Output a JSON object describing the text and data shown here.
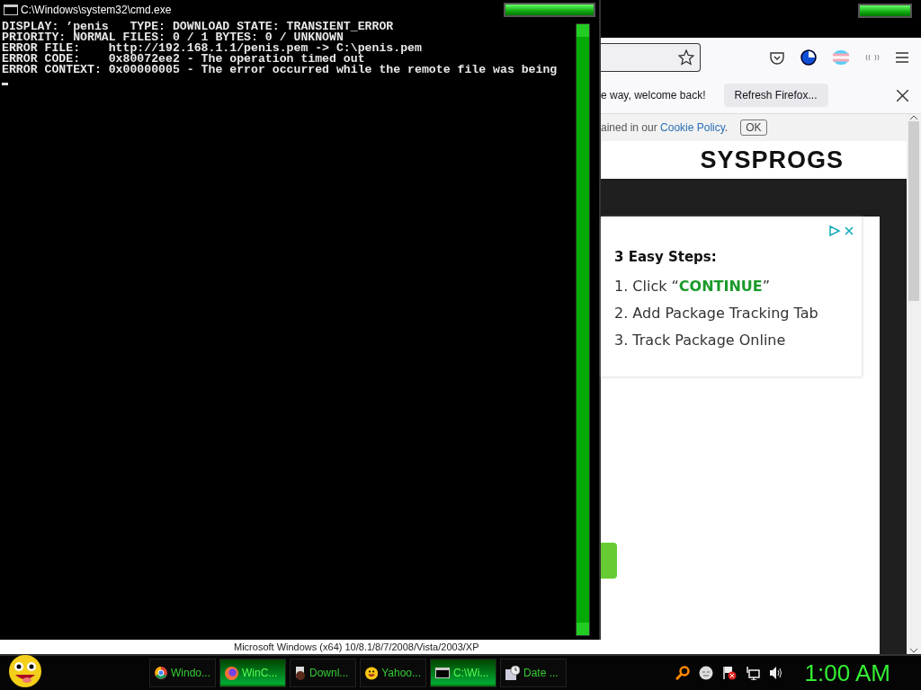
{
  "console_window": {
    "title": "C:\\Windows\\system32\\cmd.exe",
    "lines": [
      "DISPLAY: ’penis   TYPE: DOWNLOAD STATE: TRANSIENT_ERROR",
      "PRIORITY: NORMAL FILES: 0 / 1 BYTES: 0 / UNKNOWN",
      "ERROR FILE:    http://192.168.1.1/penis.pem -> C:\\penis.pem",
      "ERROR CODE:    0x80072ee2 - The operation timed out",
      "ERROR CONTEXT: 0x00000005 - The error occurred while the remote file was being"
    ]
  },
  "background_strip": {
    "text": "Microsoft Windows (x64) 10/8.1/8/7/2008/Vista/2003/XP"
  },
  "browser": {
    "notification": {
      "message": "e way, welcome back!",
      "button": "Refresh Firefox..."
    },
    "cookie_bar": {
      "text": "ained in our ",
      "link": "Cookie Policy",
      "suffix": ".",
      "button": "OK"
    },
    "logo": "SYSPROGS",
    "ad": {
      "heading": "3 Easy Steps:",
      "steps": [
        "1. Click “**CONTINUE**”",
        "2. Add Package Tracking Tab",
        "3. Track Package Online"
      ]
    }
  },
  "taskbar": {
    "tasks": [
      {
        "kind": "chrome",
        "label": "Windo...",
        "selected": false
      },
      {
        "kind": "firefox",
        "label": "WinC...",
        "selected": true
      },
      {
        "kind": "download",
        "label": "Downl...",
        "selected": false
      },
      {
        "kind": "yahoo",
        "label": "Yahoo...",
        "selected": false
      },
      {
        "kind": "console",
        "label": "C:\\Wi...",
        "selected": true
      },
      {
        "kind": "calendar",
        "label": "Date ...",
        "selected": false
      }
    ],
    "clock": "1:00 AM"
  }
}
